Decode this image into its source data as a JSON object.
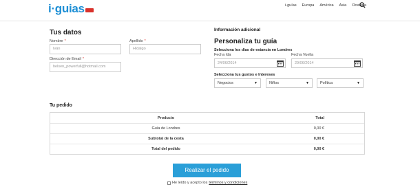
{
  "header": {
    "logo_text": "i·guias",
    "nav": [
      "i-guías",
      "Europa",
      "América",
      "Asia",
      "Oceanía"
    ]
  },
  "tus_datos": {
    "title": "Tus datos",
    "nombre_label": "Nombre",
    "nombre_value": "Iván",
    "apellido_label": "Apellido",
    "apellido_value": "Hidalgo",
    "email_label": "Dirección de Email",
    "email_value": "helsen_powerfull@hotmail.com",
    "required_mark": "*"
  },
  "info": {
    "heading": "Información adicional",
    "title": "Personaliza tu guía",
    "dates_label": "Selecciona los días de estancia en Londres",
    "ida_label": "Fecha Ida",
    "ida_value": "24/06/2014",
    "vuelta_label": "Fecha Vuelta",
    "vuelta_value": "29/06/2014",
    "interests_label": "Selecciona tus gustos e Intereses",
    "selects": [
      "Negocios",
      "Niños",
      "Política"
    ]
  },
  "order": {
    "title": "Tu pedido",
    "col_product": "Producto",
    "col_total": "Total",
    "rows": [
      {
        "label": "Guía de Londres",
        "value": "0,00 €",
        "bold": false
      },
      {
        "label": "Subtotal de la cesta",
        "value": "0,00 €",
        "bold": true
      },
      {
        "label": "Total del pedido",
        "value": "0,00 €",
        "bold": true
      }
    ]
  },
  "submit_label": "Realizar el pedido",
  "terms": {
    "prefix": "He leído y acepto los",
    "link": "términos y condiciones"
  },
  "colors": {
    "brand_blue": "#1e8fd5",
    "button_blue": "#2a9fd8",
    "required_red": "#d9312b"
  }
}
